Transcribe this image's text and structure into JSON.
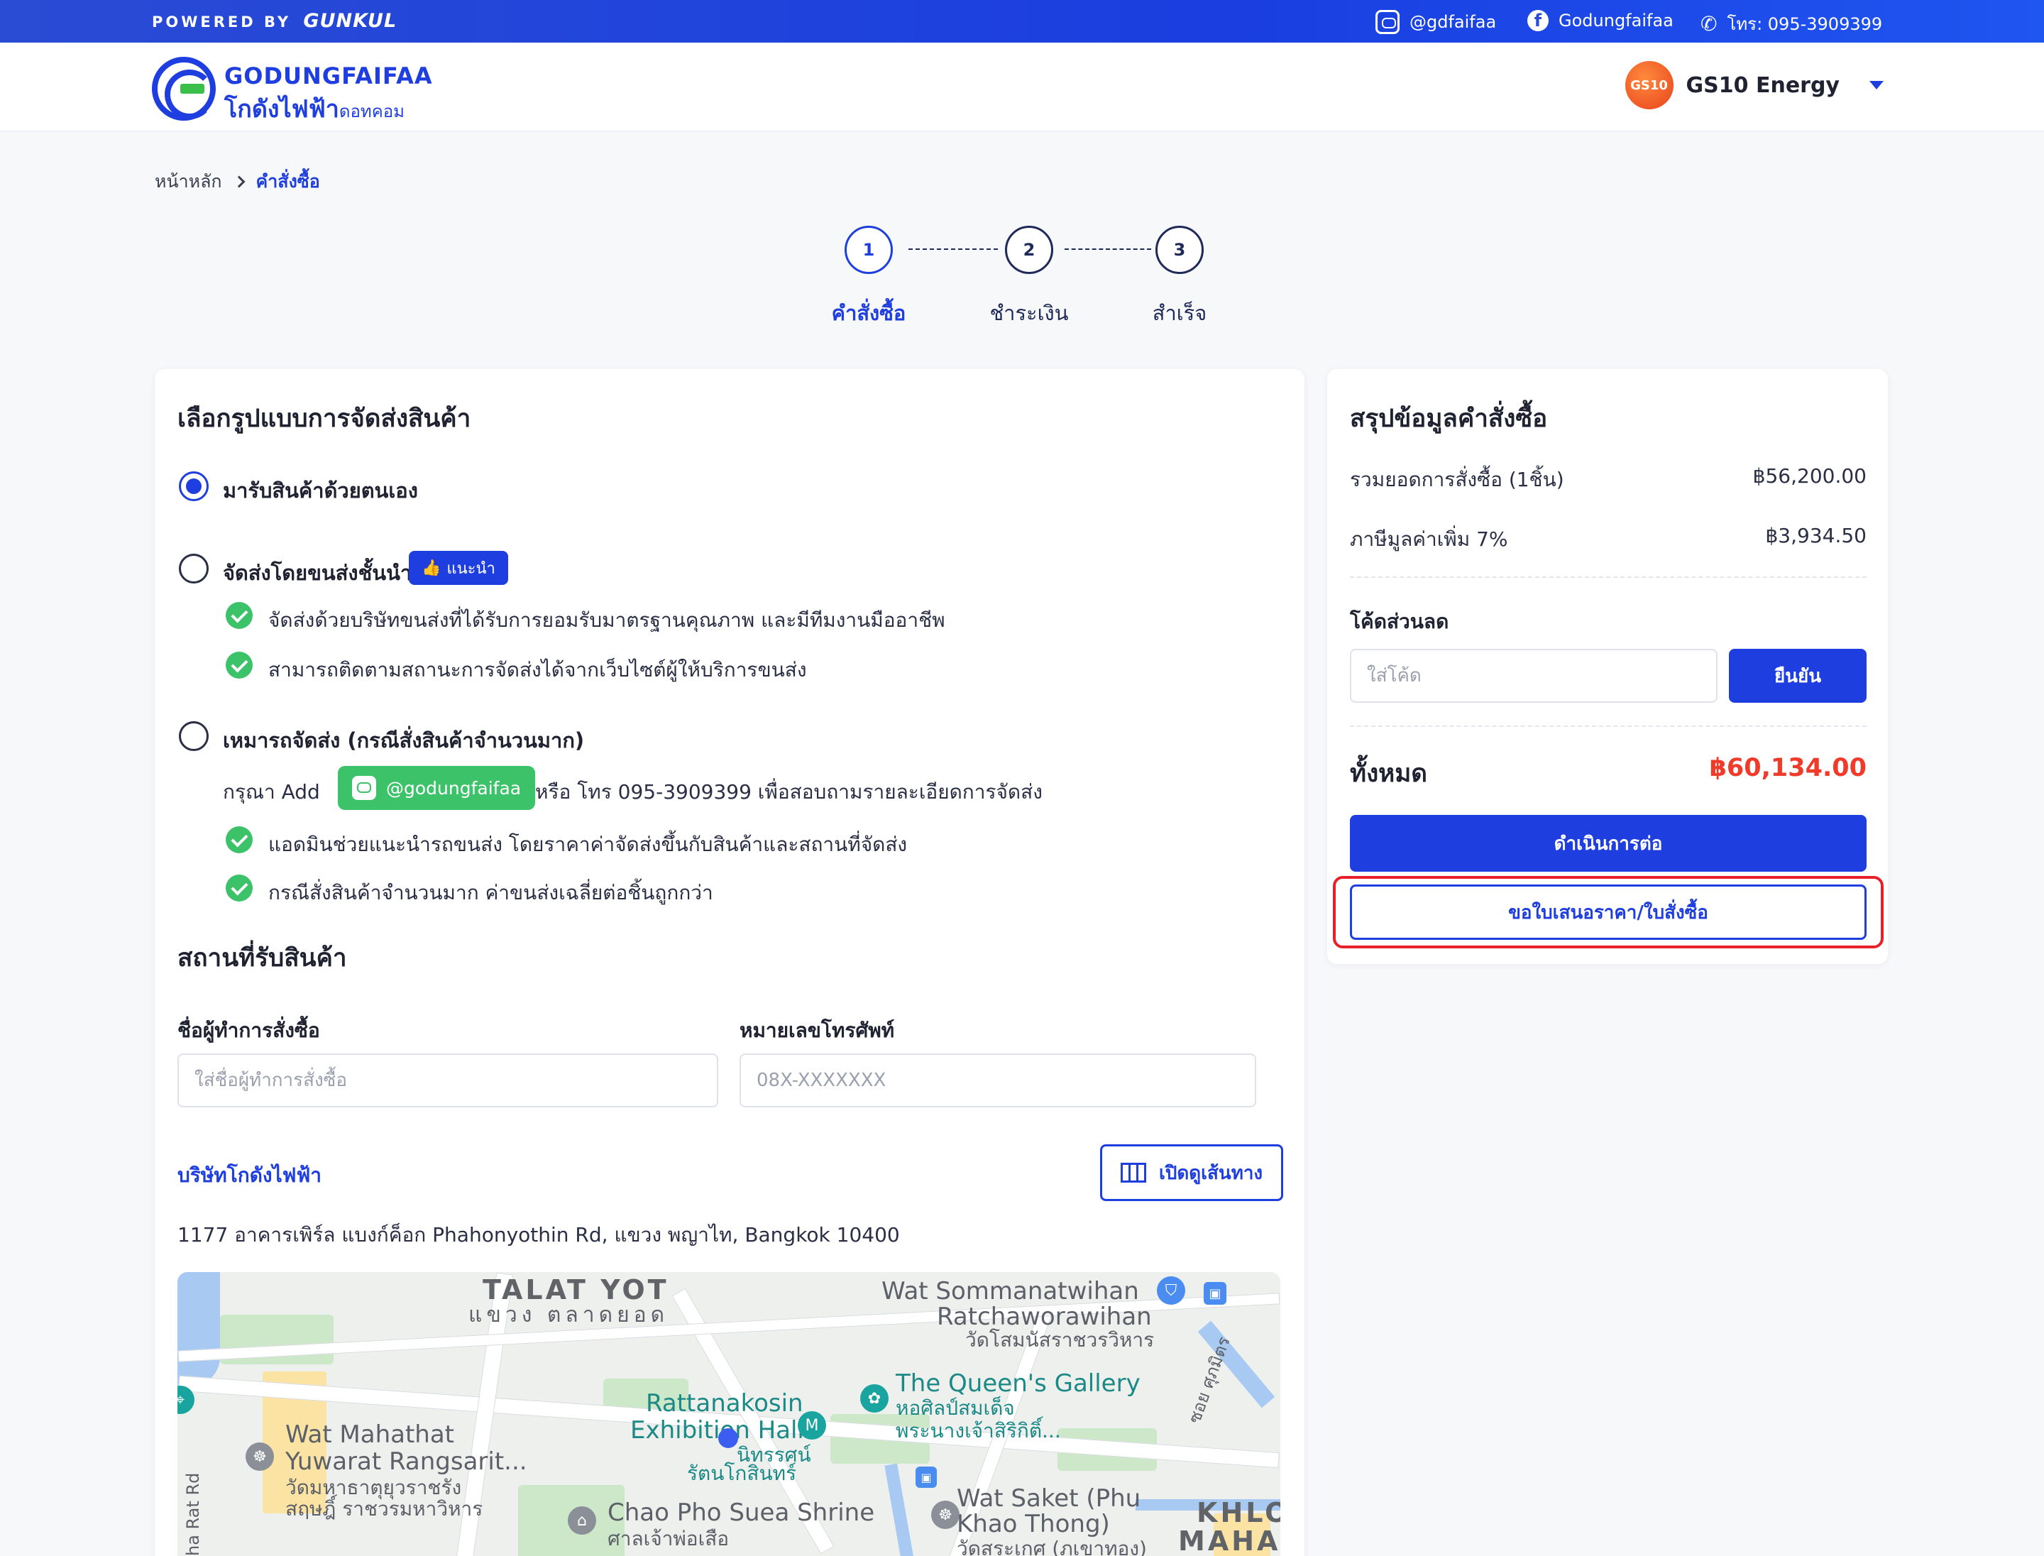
{
  "topbar": {
    "powered_label": "POWERED BY",
    "powered_brand": "GUNKUL",
    "line_handle": "@gdfaifaa",
    "facebook": "Godungfaifaa",
    "phone": "โทร: 095-3909399"
  },
  "header": {
    "logo_line1": "GODUNGFAIFAA",
    "logo_line2": "โกดังไฟฟ้า",
    "logo_line2_suffix": "ดอทคอม",
    "user_avatar_text": "GS10",
    "user_name": "GS10 Energy"
  },
  "breadcrumb": {
    "home": "หน้าหลัก",
    "current": "คำสั่งซื้อ"
  },
  "stepper": {
    "steps": [
      {
        "number": "1",
        "label": "คำสั่งซื้อ"
      },
      {
        "number": "2",
        "label": "ชำระเงิน"
      },
      {
        "number": "3",
        "label": "สำเร็จ"
      }
    ]
  },
  "shipping": {
    "title": "เลือกรูปแบบการจัดส่งสินค้า",
    "option_pickup": "มารับสินค้าด้วยตนเอง",
    "option_courier": "จัดส่งโดยขนส่งชั้นนำ",
    "recommend_badge": "แนะนำ",
    "courier_points": [
      "จัดส่งด้วยบริษัทขนส่งที่ได้รับการยอมรับมาตรฐานคุณภาพ และมีทีมงานมืออาชีพ",
      "สามารถติดตามสถานะการจัดส่งได้จากเว็บไซต์ผู้ให้บริการขนส่ง"
    ],
    "option_truck": "เหมารถจัดส่ง (กรณีสั่งสินค้าจำนวนมาก)",
    "truck_prefix": "กรุณา Add",
    "truck_line_id": "@godungfaifaa",
    "truck_suffix": "หรือ โทร 095-3909399 เพื่อสอบถามรายละเอียดการจัดส่ง",
    "truck_points": [
      "แอดมินช่วยแนะนำรถขนส่ง โดยราคาค่าจัดส่งขึ้นกับสินค้าและสถานที่จัดส่ง",
      "กรณีสั่งสินค้าจำนวนมาก ค่าขนส่งเฉลี่ยต่อชิ้นถูกกว่า"
    ]
  },
  "pickup": {
    "title": "สถานที่รับสินค้า",
    "name_label": "ชื่อผู้ทำการสั่งซื้อ",
    "name_placeholder": "ใส่ชื่อผู้ทำการสั่งซื้อ",
    "phone_label": "หมายเลขโทรศัพท์",
    "phone_placeholder": "08X-XXXXXXX",
    "company": "บริษัทโกดังไฟฟ้า",
    "route_button": "เปิดดูเส้นทาง",
    "address": "1177 อาคารเพิร์ล แบงก์ค็อก Phahonyothin Rd, แขวง พญาไท, Bangkok 10400"
  },
  "map": {
    "labels": {
      "talat_yot_en": "TALAT YOT",
      "talat_yot_th": "แขวง ตลาดยอด",
      "wat_som_en1": "Wat Sommanatwihan",
      "wat_som_en2": "Ratchaworawihan",
      "wat_som_th": "วัดโสมนัสราชวรวิหาร",
      "queens_en": "The Queen's Gallery",
      "queens_th1": "หอศิลป์สมเด็จ",
      "queens_th2": "พระนางเจ้าสิริกิติ์...",
      "ratt_en1": "Rattanakosin",
      "ratt_en2": "Exhibition Hall",
      "ratt_th1": "นิทรรศน์",
      "ratt_th2": "รัตนโกสินทร์",
      "mahathat_en1": "Wat Mahathat",
      "mahathat_en2": "Yuwarat Rangsarit...",
      "mahathat_th1": "วัดมหาธาตุยุวราชรัง",
      "mahathat_th2": "สฤษฎิ์ ราชวรมหาวิหาร",
      "chao_pho_en": "Chao Pho Suea Shrine",
      "chao_pho_th": "ศาลเจ้าพ่อเสือ",
      "saket_en1": "Wat Saket (Phu",
      "saket_en2": "Khao Thong)",
      "saket_th": "วัดสระเกศ (ภูเขาทอง)",
      "khlo": "KHLO",
      "maha": "MAHA",
      "soi": "ซอย ศุภมิตร",
      "road": "ha Rat Rd"
    }
  },
  "summary": {
    "title": "สรุปข้อมูลคำสั่งซื้อ",
    "subtotal_label": "รวมยอดการสั่งซื้อ (1ชิ้น)",
    "subtotal_value": "฿56,200.00",
    "vat_label": "ภาษีมูลค่าเพิ่ม 7%",
    "vat_value": "฿3,934.50",
    "discount_label": "โค้ดส่วนลด",
    "discount_placeholder": "ใส่โค้ด",
    "confirm_button": "ยืนยัน",
    "total_label": "ทั้งหมด",
    "total_value": "฿60,134.00",
    "proceed_button": "ดำเนินการต่อ",
    "quote_button": "ขอใบเสนอราคา/ใบสั่งซื้อ"
  },
  "colors": {
    "primary": "#1f3ee0",
    "success": "#3cc36a",
    "total_red": "#f03a2a",
    "highlight_red": "#e8202a"
  }
}
